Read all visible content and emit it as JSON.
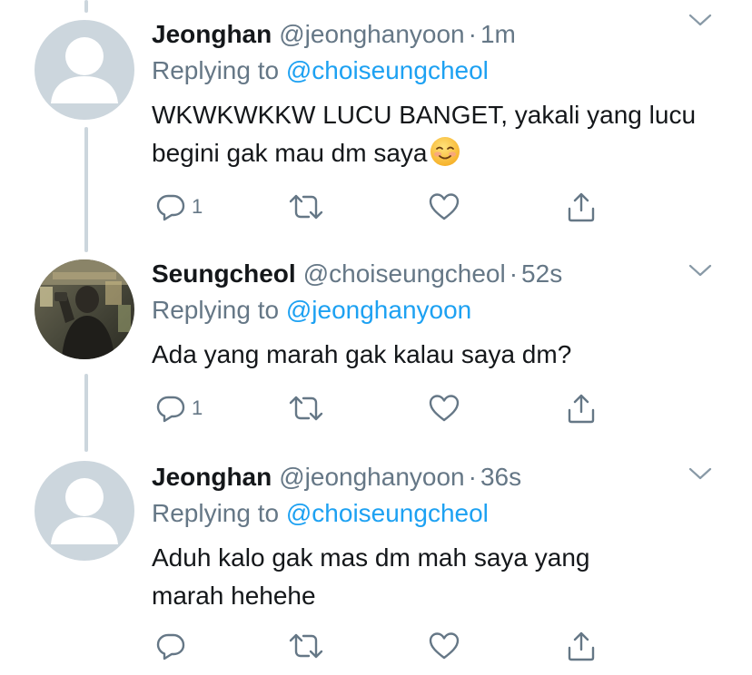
{
  "tweets": [
    {
      "display_name": "Jeonghan",
      "handle": "@jeonghanyoon",
      "separator": "·",
      "time": "1m",
      "reply_prefix": "Replying to",
      "reply_to": "@choiseungcheol",
      "text": "WKWKWKKW LUCU BANGET, yakali yang lucu begini gak mau dm saya",
      "emoji": "smiling-face-emoji",
      "reply_count": "1",
      "avatar": "default-avatar"
    },
    {
      "display_name": "Seungcheol",
      "handle": "@choiseungcheol",
      "separator": "·",
      "time": "52s",
      "reply_prefix": "Replying to",
      "reply_to": "@jeonghanyoon",
      "text": "Ada yang marah gak kalau saya dm?",
      "reply_count": "1",
      "avatar": "photo-avatar"
    },
    {
      "display_name": "Jeonghan",
      "handle": "@jeonghanyoon",
      "separator": "·",
      "time": "36s",
      "reply_prefix": "Replying to",
      "reply_to": "@choiseungcheol",
      "text": "Aduh kalo gak mas dm mah saya yang marah hehehe",
      "reply_count": "",
      "avatar": "default-avatar"
    }
  ],
  "icons": {
    "reply": "reply-icon",
    "retweet": "retweet-icon",
    "like": "heart-icon",
    "share": "share-icon",
    "caret": "chevron-down-icon"
  },
  "colors": {
    "text": "#14171a",
    "muted": "#657786",
    "link": "#1da1f2",
    "thread_line": "#ccd6dd",
    "avatar_bg": "#ccd6dd"
  }
}
